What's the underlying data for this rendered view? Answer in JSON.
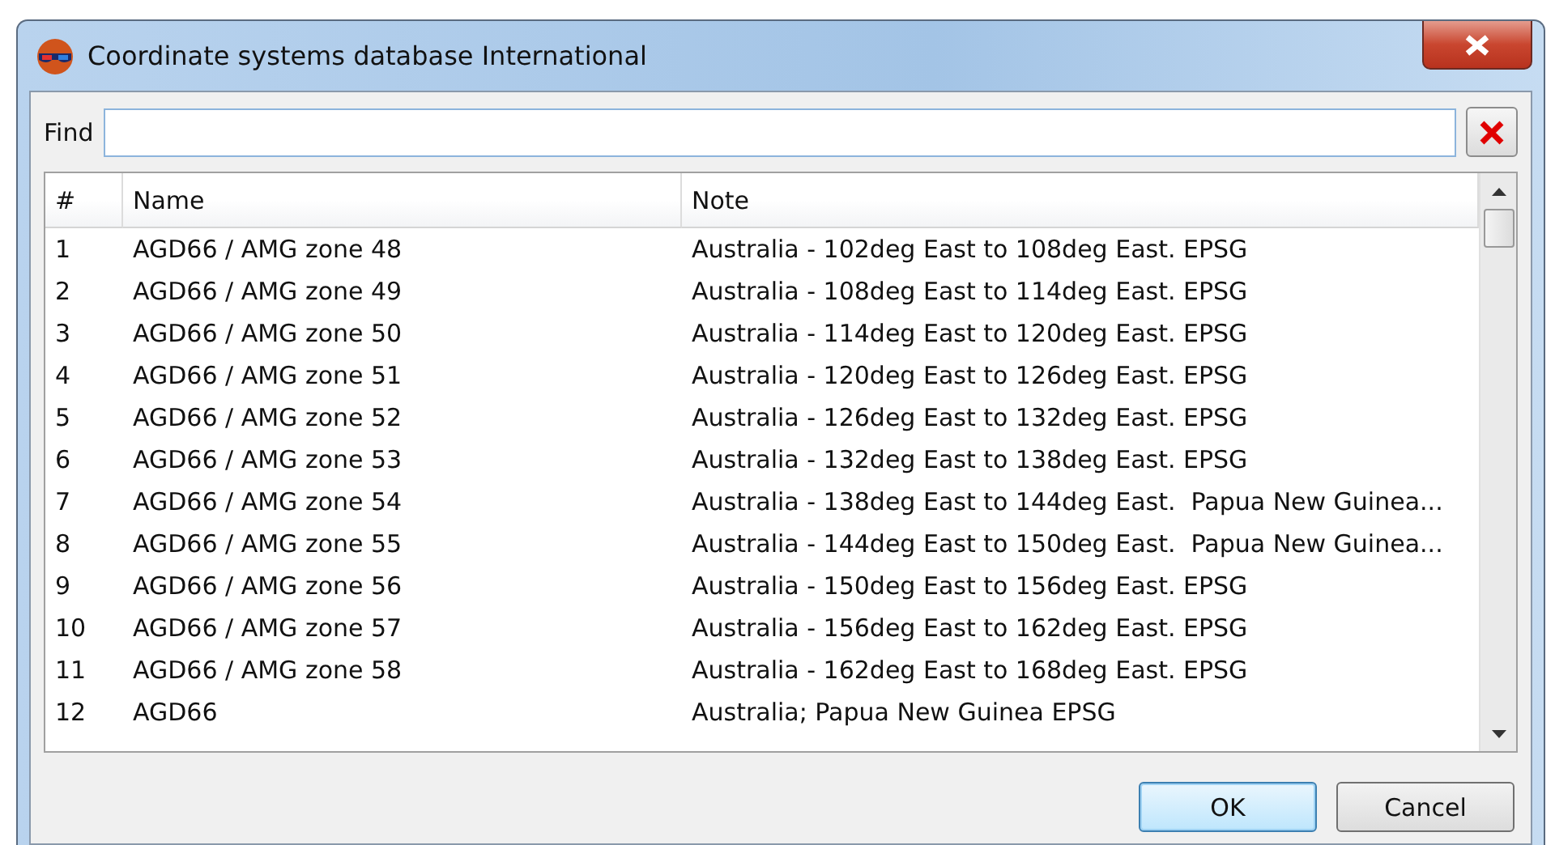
{
  "window": {
    "title": "Coordinate systems database International"
  },
  "find": {
    "label": "Find"
  },
  "table": {
    "columns": [
      "#",
      "Name",
      "Note"
    ],
    "rows": [
      {
        "num": "1",
        "name": "AGD66 / AMG zone 48",
        "note": "Australia - 102deg East to 108deg East. EPSG",
        "selected": false
      },
      {
        "num": "2",
        "name": "AGD66 / AMG zone 49",
        "note": "Australia - 108deg East to 114deg East. EPSG",
        "selected": false
      },
      {
        "num": "3",
        "name": "AGD66 / AMG zone 50",
        "note": "Australia - 114deg East to 120deg East. EPSG",
        "selected": false
      },
      {
        "num": "4",
        "name": "AGD66 / AMG zone 51",
        "note": "Australia - 120deg East to 126deg East. EPSG",
        "selected": false
      },
      {
        "num": "5",
        "name": "AGD66 / AMG zone 52",
        "note": "Australia - 126deg East to 132deg East. EPSG",
        "selected": false
      },
      {
        "num": "6",
        "name": "AGD66 / AMG zone 53",
        "note": "Australia - 132deg East to 138deg East. EPSG",
        "selected": false
      },
      {
        "num": "7",
        "name": "AGD66 / AMG zone 54",
        "note": "Australia - 138deg East to 144deg East.  Papua New Guinea...",
        "selected": false
      },
      {
        "num": "8",
        "name": "AGD66 / AMG zone 55",
        "note": "Australia - 144deg East to 150deg East.  Papua New Guinea...",
        "selected": false
      },
      {
        "num": "9",
        "name": "AGD66 / AMG zone 56",
        "note": "Australia - 150deg East to 156deg East. EPSG",
        "selected": false
      },
      {
        "num": "10",
        "name": "AGD66 / AMG zone 57",
        "note": "Australia - 156deg East to 162deg East. EPSG",
        "selected": false
      },
      {
        "num": "11",
        "name": "AGD66 / AMG zone 58",
        "note": "Australia - 162deg East to 168deg East. EPSG",
        "selected": false
      },
      {
        "num": "12",
        "name": "AGD66",
        "note": "Australia; Papua New Guinea EPSG",
        "selected": false
      }
    ]
  },
  "buttons": [
    {
      "label": "OK",
      "default": true
    },
    {
      "label": "Cancel",
      "default": false
    }
  ]
}
